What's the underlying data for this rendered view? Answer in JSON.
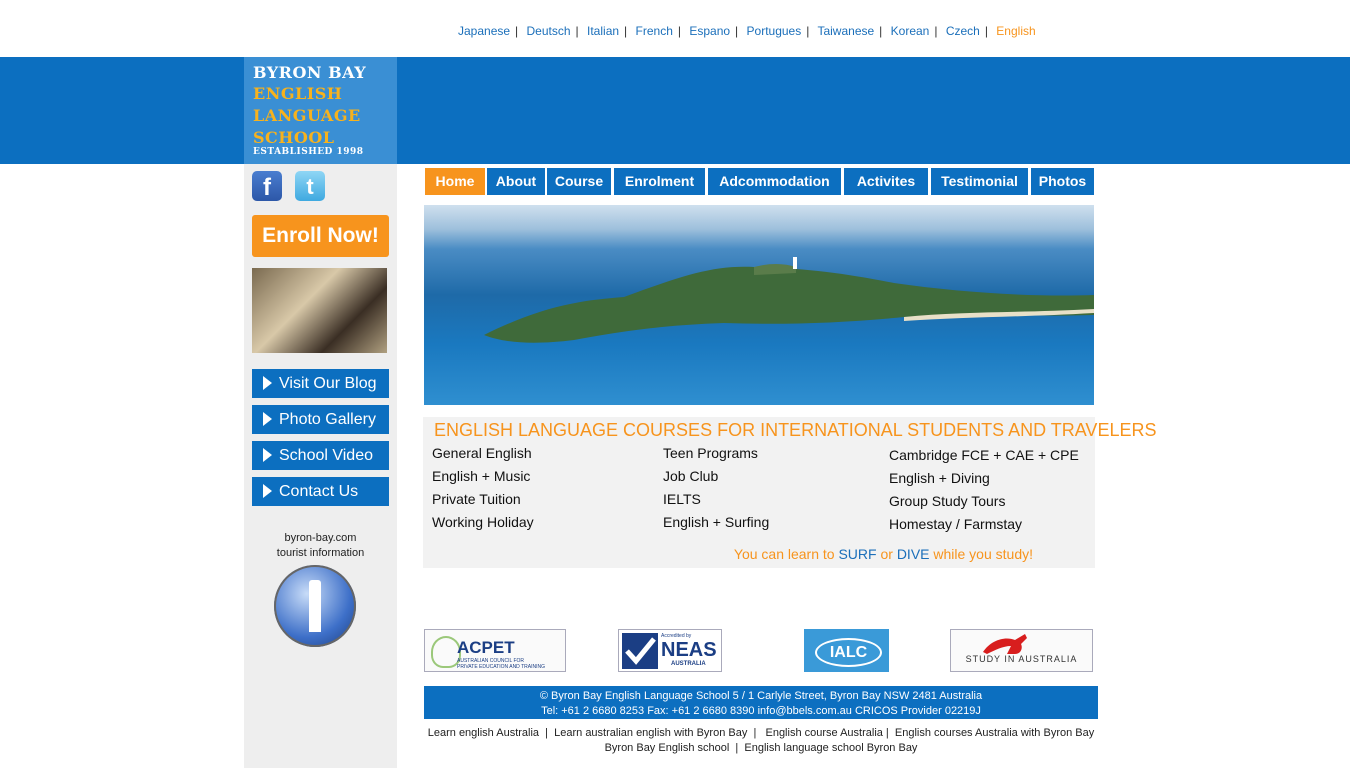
{
  "languages": {
    "items": [
      "Japanese",
      "Deutsch",
      "Italian",
      "French",
      "Espano",
      "Portugues",
      "Taiwanese",
      "Korean",
      "Czech",
      "English"
    ],
    "active": "English"
  },
  "logo": {
    "line1": "BYRON BAY",
    "line2": "ENGLISH",
    "line3": "LANGUAGE",
    "line4": "SCHOOL",
    "line5": "ESTABLISHED 1998"
  },
  "social": {
    "facebook_icon": "f",
    "twitter_icon": "t"
  },
  "sidebar": {
    "enroll": "Enroll Now!",
    "buttons": [
      "Visit Our Blog",
      "Photo Gallery",
      "School Video",
      "Contact Us"
    ],
    "tourist_line1": "byron-bay.com",
    "tourist_line2": "tourist information"
  },
  "nav": {
    "tabs": [
      "Home",
      "About",
      "Course",
      "Enrolment",
      "Adcommodation",
      "Activites",
      "Testimonial",
      "Photos"
    ]
  },
  "courses": {
    "heading": "ENGLISH LANGUAGE COURSES FOR INTERNATIONAL STUDENTS AND TRAVELERS",
    "col1": [
      "General English",
      "English + Music",
      "Private Tuition",
      "Working Holiday"
    ],
    "col2": [
      "Teen Programs",
      "Job Club",
      "IELTS",
      "English + Surfing"
    ],
    "col3": [
      "Cambridge FCE + CAE + CPE",
      "English + Diving",
      "Group Study Tours",
      "Homestay / Farmstay"
    ],
    "learn_prefix": "You can learn to ",
    "learn_surf": "SURF",
    "learn_or": " or ",
    "learn_dive": "DIVE",
    "learn_suffix": " while you study!"
  },
  "accreditations": {
    "acpet_title": "ACPET",
    "acpet_sub1": "AUSTRALIAN COUNCIL FOR",
    "acpet_sub2": "PRIVATE EDUCATION AND TRAINING",
    "neas_top": "Accredited by",
    "neas": "NEAS",
    "neas_sub": "AUSTRALIA",
    "ialc": "IALC",
    "study": "STUDY IN AUSTRALIA"
  },
  "footer": {
    "line1": "© Byron Bay English Language School 5 / 1 Carlyle Street, Byron Bay NSW 2481 Australia",
    "line2": "Tel: +61 2 6680 8253 Fax: +61 2 6680 8390 info@bbels.com.au  CRICOS Provider 02219J"
  },
  "seo_links": {
    "line1": "Learn english Australia  |  Learn australian english with Byron Bay  |   English course Australia |  English courses Australia with Byron Bay",
    "line2": "Byron Bay English school  |  English language school Byron Bay"
  },
  "colors": {
    "brand_blue": "#0c6fc0",
    "accent_orange": "#f7941d",
    "link_blue": "#1b6fba"
  }
}
